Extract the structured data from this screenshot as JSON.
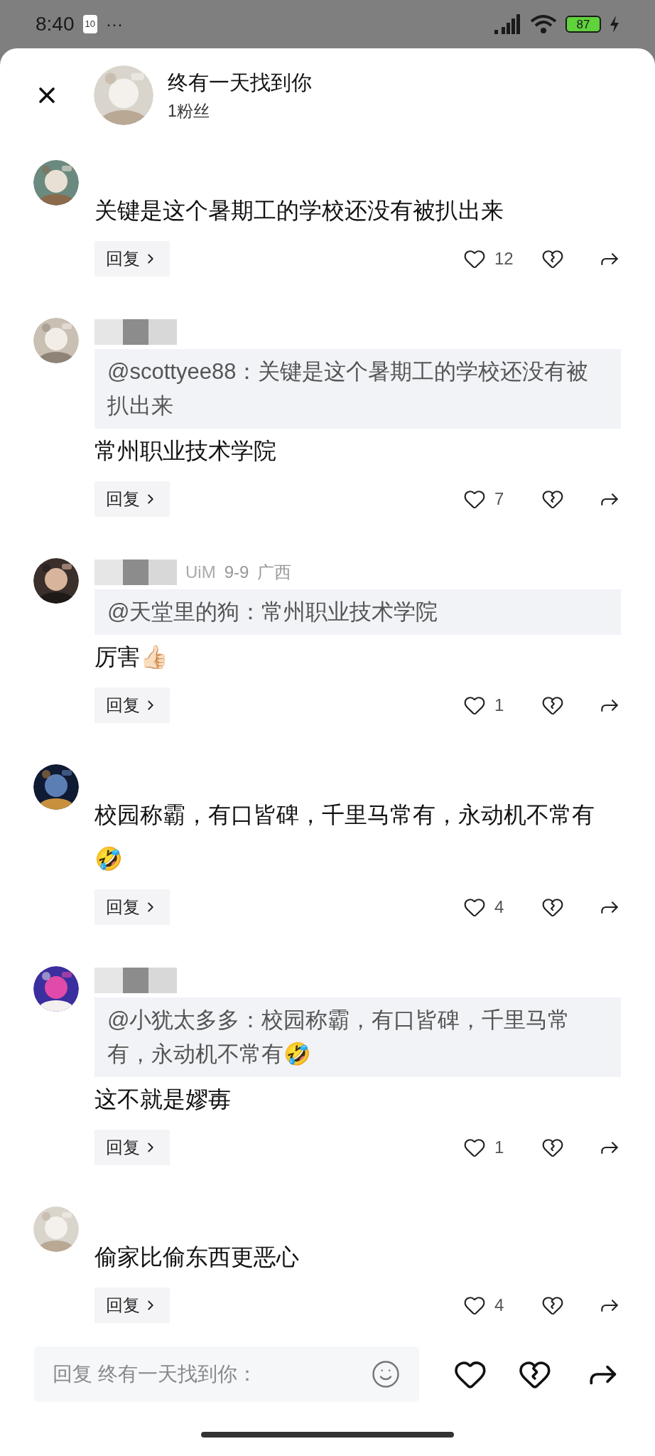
{
  "status_bar": {
    "time": "8:40",
    "notification_badge": "10",
    "more": "···",
    "battery": "87"
  },
  "header": {
    "title": "终有一天找到你",
    "subtitle": "1粉丝"
  },
  "comments": [
    {
      "name_redacted": false,
      "text": "关键是这个暑期工的学校还没有被扒出来",
      "reply": "回复",
      "likes": "12"
    },
    {
      "name_redacted": true,
      "quote": "@scottyee88：关键是这个暑期工的学校还没有被扒出来",
      "text": "常州职业技术学院",
      "reply": "回复",
      "likes": "7"
    },
    {
      "name_redacted": true,
      "name": "UiM",
      "meta": [
        "9-9",
        "广西"
      ],
      "quote": "@天堂里的狗：常州职业技术学院",
      "text": "厉害👍🏻",
      "reply": "回复",
      "likes": "1"
    },
    {
      "name_redacted": false,
      "text": "校园称霸，有口皆碑，千里马常有，永动机不常有🤣",
      "reply": "回复",
      "likes": "4"
    },
    {
      "name_redacted": true,
      "quote": "@小犹太多多：校园称霸，有口皆碑，千里马常有，永动机不常有🤣",
      "text": "这不就是嫪毐",
      "reply": "回复",
      "likes": "1"
    },
    {
      "name_redacted": false,
      "text": "偷家比偷东西更恶心",
      "reply": "回复",
      "likes": "4"
    }
  ],
  "reply_bar": {
    "placeholder": "回复 终有一天找到你："
  }
}
